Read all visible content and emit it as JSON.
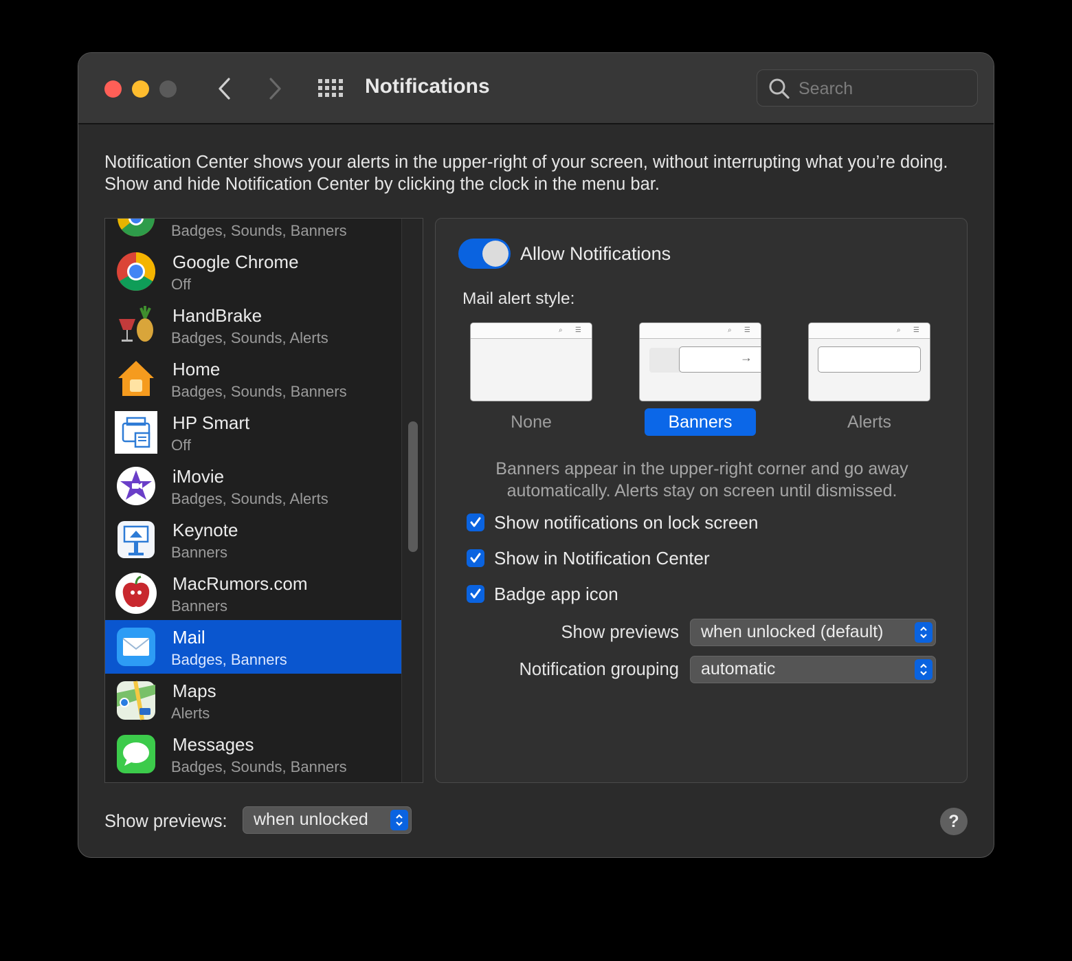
{
  "window": {
    "title": "Notifications",
    "search_placeholder": "Search"
  },
  "description": "Notification Center shows your alerts in the upper-right of your screen, without interrupting what you’re doing. Show and hide Notification Center by clicking the clock in the menu bar.",
  "app_list": [
    {
      "name": "",
      "subtitle": "Badges, Sounds, Banners",
      "icon": "app-partial-icon"
    },
    {
      "name": "Google Chrome",
      "subtitle": "Off",
      "icon": "chrome-icon"
    },
    {
      "name": "HandBrake",
      "subtitle": "Badges, Sounds, Alerts",
      "icon": "handbrake-icon"
    },
    {
      "name": "Home",
      "subtitle": "Badges, Sounds, Banners",
      "icon": "home-icon"
    },
    {
      "name": "HP Smart",
      "subtitle": "Off",
      "icon": "hp-smart-icon"
    },
    {
      "name": "iMovie",
      "subtitle": "Badges, Sounds, Alerts",
      "icon": "imovie-icon"
    },
    {
      "name": "Keynote",
      "subtitle": "Banners",
      "icon": "keynote-icon"
    },
    {
      "name": "MacRumors.com",
      "subtitle": "Banners",
      "icon": "macrumors-icon"
    },
    {
      "name": "Mail",
      "subtitle": "Badges, Banners",
      "icon": "mail-icon",
      "selected": true
    },
    {
      "name": "Maps",
      "subtitle": "Alerts",
      "icon": "maps-icon"
    },
    {
      "name": "Messages",
      "subtitle": "Badges, Sounds, Banners",
      "icon": "messages-icon"
    }
  ],
  "detail": {
    "allow_label": "Allow Notifications",
    "allow_enabled": true,
    "alert_style_label": "Mail alert style:",
    "styles": [
      {
        "label": "None",
        "selected": false
      },
      {
        "label": "Banners",
        "selected": true
      },
      {
        "label": "Alerts",
        "selected": false
      }
    ],
    "style_help": "Banners appear in the upper-right corner and go away automatically. Alerts stay on screen until dismissed.",
    "checkboxes": [
      {
        "label": "Show notifications on lock screen",
        "checked": true
      },
      {
        "label": "Show in Notification Center",
        "checked": true
      },
      {
        "label": "Badge app icon",
        "checked": true
      }
    ],
    "show_previews_label": "Show previews",
    "show_previews_value": "when unlocked (default)",
    "grouping_label": "Notification grouping",
    "grouping_value": "automatic"
  },
  "footer": {
    "show_previews_label": "Show previews:",
    "show_previews_value": "when unlocked",
    "help_label": "?"
  },
  "colors": {
    "accent": "#0a63e0",
    "selection": "#0a56cf",
    "window_bg": "#2b2b2b"
  }
}
